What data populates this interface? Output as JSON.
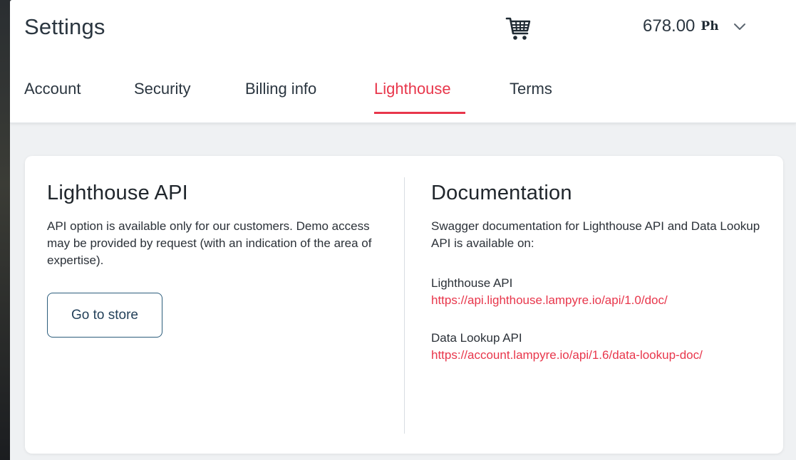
{
  "header": {
    "title": "Settings",
    "cart_icon": "shopping-cart-icon",
    "balance": {
      "amount": "678.00",
      "unit": "Ph",
      "dropdown_icon": "chevron-down-icon"
    }
  },
  "tabs": [
    {
      "label": "Account",
      "active": false
    },
    {
      "label": "Security",
      "active": false
    },
    {
      "label": "Billing info",
      "active": false
    },
    {
      "label": "Lighthouse",
      "active": true
    },
    {
      "label": "Terms",
      "active": false
    }
  ],
  "colors": {
    "accent": "#e8364b",
    "text": "#2b3640",
    "button_border": "#2c5d7c"
  },
  "lighthouse_api": {
    "title": "Lighthouse API",
    "description": "API option is available only for our customers. Demo access may be provided by request (with an indication of the area of expertise).",
    "button_label": "Go to store"
  },
  "documentation": {
    "title": "Documentation",
    "description": "Swagger documentation for Lighthouse API and Data Lookup API is available on:",
    "links": [
      {
        "label": "Lighthouse API",
        "url": "https://api.lighthouse.lampyre.io/api/1.0/doc/"
      },
      {
        "label": "Data Lookup API",
        "url": "https://account.lampyre.io/api/1.6/data-lookup-doc/"
      }
    ]
  }
}
